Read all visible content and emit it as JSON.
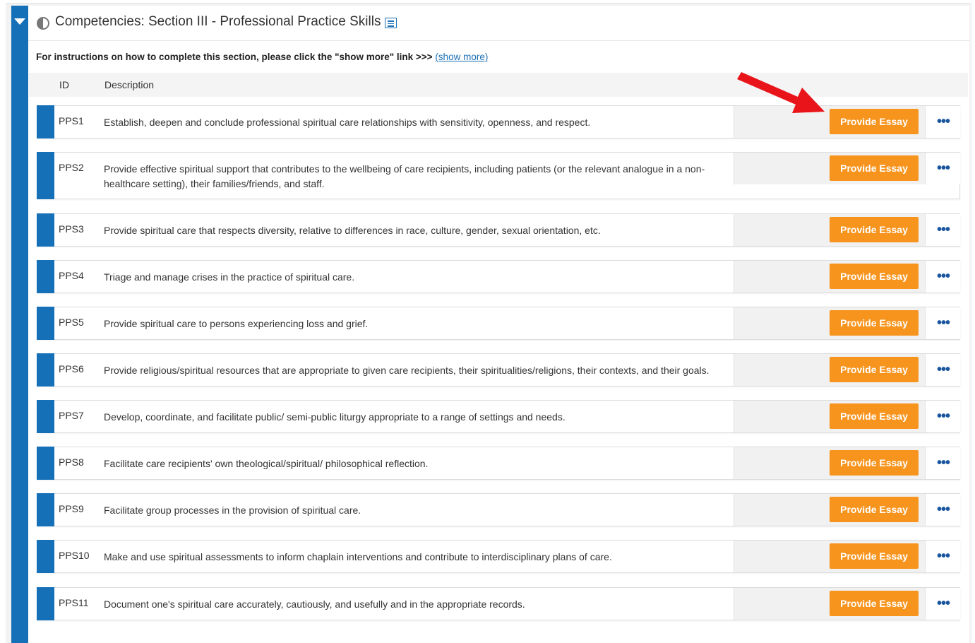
{
  "section": {
    "title": "Competencies: Section III - Professional Practice Skills",
    "instructions": "For instructions on how to complete this section, please click the \"show more\" link >>> ",
    "show_more": "(show more)"
  },
  "table": {
    "columns": {
      "id": "ID",
      "description": "Description"
    },
    "rows": [
      {
        "id": "PPS1",
        "description": "Establish, deepen and conclude professional spiritual care relationships with sensitivity, openness, and respect.",
        "button": "Provide Essay"
      },
      {
        "id": "PPS2",
        "description": "Provide effective spiritual support that contributes to the wellbeing of care recipients, including patients (or the relevant analogue in a non-healthcare setting), their families/friends, and staff.",
        "button": "Provide Essay"
      },
      {
        "id": "PPS3",
        "description": "Provide spiritual care that respects diversity, relative to differences in race, culture, gender, sexual orientation, etc.",
        "button": "Provide Essay"
      },
      {
        "id": "PPS4",
        "description": "Triage and manage crises in the practice of spiritual care.",
        "button": "Provide Essay"
      },
      {
        "id": "PPS5",
        "description": "Provide spiritual care to persons experiencing loss and grief.",
        "button": "Provide Essay"
      },
      {
        "id": "PPS6",
        "description": "Provide religious/spiritual resources that are appropriate to given care recipients, their spiritualities/religions, their contexts, and their goals.",
        "button": "Provide Essay"
      },
      {
        "id": "PPS7",
        "description": "Develop, coordinate, and facilitate public/ semi-public liturgy appropriate to a range of settings and needs.",
        "button": "Provide Essay"
      },
      {
        "id": "PPS8",
        "description": "Facilitate care recipients' own theological/spiritual/ philosophical reflection.",
        "button": "Provide Essay"
      },
      {
        "id": "PPS9",
        "description": "Facilitate group processes in the provision of spiritual care.",
        "button": "Provide Essay"
      },
      {
        "id": "PPS10",
        "description": "Make and use spiritual assessments to inform chaplain interventions and contribute to interdisciplinary plans of care.",
        "button": "Provide Essay"
      },
      {
        "id": "PPS11",
        "description": "Document one's spiritual care accurately, cautiously, and usefully and in the appropriate records.",
        "button": "Provide Essay"
      }
    ]
  },
  "more_label": "•••",
  "colors": {
    "accent_blue": "#1570b8",
    "button_orange": "#f7941d",
    "arrow_red": "#e8141a"
  },
  "icons": {
    "toggle": "caret-down-icon",
    "status": "half-circle-icon",
    "details": "list-icon",
    "more": "ellipsis-icon",
    "annotation": "red-arrow"
  }
}
